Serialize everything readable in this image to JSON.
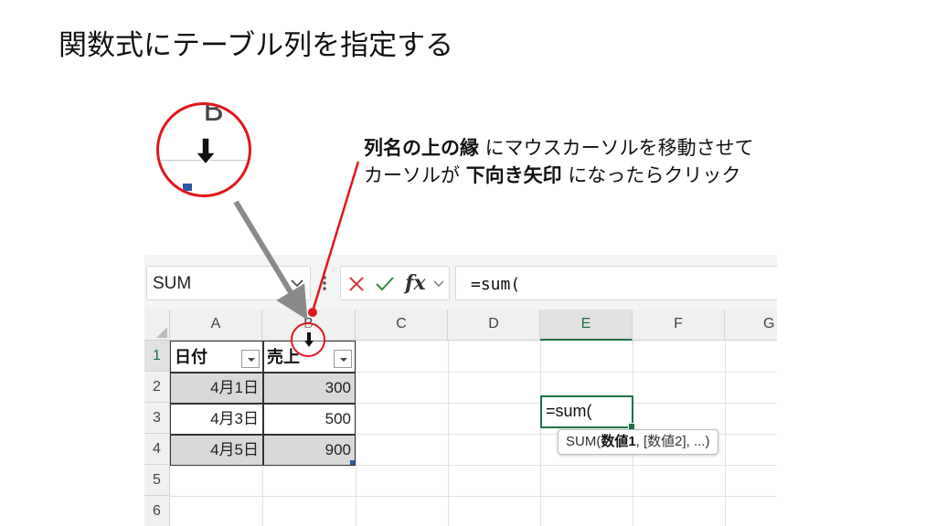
{
  "slide": {
    "title": "関数式にテーブル列を指定する",
    "callout": {
      "line1_bold": "列名の上の縁",
      "line1_rest": " にマウスカーソルを移動させて",
      "line2_start": "カーソルが ",
      "line2_bold": "下向き矢印",
      "line2_end": " になったらクリック"
    },
    "zoom_letter": "B"
  },
  "colors": {
    "accent_red": "#e0161c",
    "excel_green": "#1f7246",
    "arrow_gray": "#8a8a8a",
    "table_fill": "#d9d9d9"
  },
  "excel": {
    "name_box": {
      "value": "SUM"
    },
    "formula_bar": {
      "cancel_icon": "x-icon",
      "enter_icon": "check-icon",
      "fx_label": "fx",
      "value": "=sum("
    },
    "columns": [
      "A",
      "B",
      "C",
      "D",
      "E",
      "F",
      "G"
    ],
    "rows": [
      "1",
      "2",
      "3",
      "4",
      "5",
      "6"
    ],
    "table": {
      "headers": [
        "日付",
        "売上"
      ],
      "rows": [
        [
          "4月1日",
          "300"
        ],
        [
          "4月3日",
          "500"
        ],
        [
          "4月5日",
          "900"
        ]
      ]
    },
    "active_cell": {
      "column": "E",
      "row": "1",
      "value": "=sum("
    },
    "tooltip": {
      "fn": "SUM(",
      "arg1": "数値1",
      "rest": ", [数値2], ...)"
    }
  }
}
